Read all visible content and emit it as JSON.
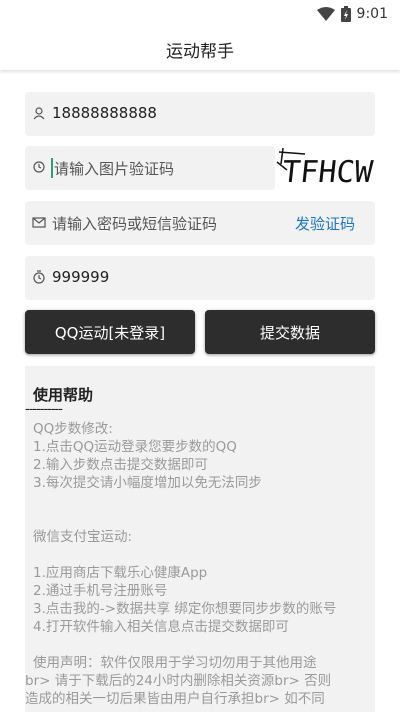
{
  "status": {
    "time": "9:01"
  },
  "app": {
    "title": "运动帮手"
  },
  "form": {
    "phone_value": "18888888888",
    "captcha_placeholder": "请输入图片验证码",
    "captcha_image_text": "TFHCW",
    "code_placeholder": "请输入密码或短信验证码",
    "get_code_label": "发验证码",
    "steps_value": "999999"
  },
  "buttons": {
    "qq_login": "QQ运动[未登录]",
    "submit": "提交数据"
  },
  "help": {
    "title": "使用帮助",
    "separator": "----------",
    "qq_title": "QQ步数修改:",
    "qq_lines": [
      "1.点击QQ运动登录您要步数的QQ",
      "2.输入步数点击提交数据即可",
      "3.每次提交请小幅度增加以免无法同步"
    ],
    "wx_title": "微信支付宝运动:",
    "wx_lines": [
      "1.应用商店下载乐心健康App",
      "2.通过手机号注册账号",
      "3.点击我的->数据共享 绑定你想要同步步数的账号",
      "4.打开软件输入相关信息点击提交数据即可"
    ],
    "disclaimer_lines": [
      "使用声明：软件仅限用于学习切勿用于其他用途",
      "br> 请于下载后的24小时内删除相关资源br> 否则",
      "造成的相关一切后果皆由用户自行承担br> 如不同"
    ]
  }
}
